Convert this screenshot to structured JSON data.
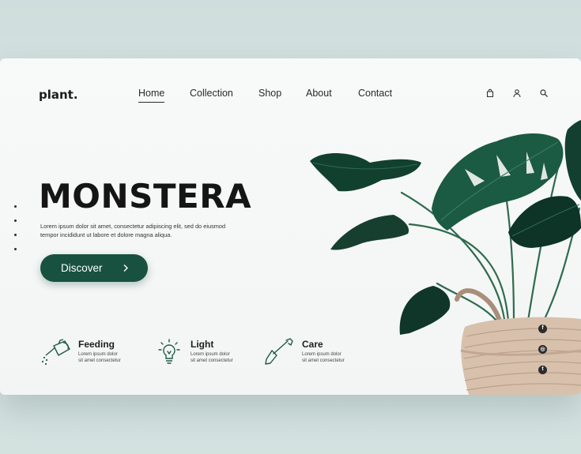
{
  "brand": {
    "logo": "plant."
  },
  "nav": {
    "items": [
      {
        "label": "Home",
        "active": true
      },
      {
        "label": "Collection",
        "active": false
      },
      {
        "label": "Shop",
        "active": false
      },
      {
        "label": "About",
        "active": false
      },
      {
        "label": "Contact",
        "active": false
      }
    ],
    "icons": [
      "bag-icon",
      "user-icon",
      "search-icon"
    ]
  },
  "hero": {
    "title": "MONSTERA",
    "description_line1": "Lorem ipsum dolor sit amet, consectetur adipiscing elit, sed do eiusmod",
    "description_line2": "tempor incididunt ut labore et dolore magna aliqua.",
    "cta_label": "Discover",
    "slide_count": 4
  },
  "features": [
    {
      "title": "Feeding",
      "line1": "Lorem ipsum dolor",
      "line2": "sit amet consectetur",
      "icon": "watering-can-icon"
    },
    {
      "title": "Light",
      "line1": "Lorem ipsum dolor",
      "line2": "sit amet consectetur",
      "icon": "light-bulb-icon"
    },
    {
      "title": "Care",
      "line1": "Lorem ipsum dolor",
      "line2": "sit amet consectetur",
      "icon": "shovel-icon"
    }
  ],
  "social": [
    {
      "name": "facebook-icon",
      "glyph": "f"
    },
    {
      "name": "dribbble-icon",
      "glyph": "◎"
    },
    {
      "name": "twitter-icon",
      "glyph": "t"
    }
  ],
  "colors": {
    "accent": "#18513f",
    "leaf_dark": "#123d31",
    "leaf_mid": "#1f5a45",
    "basket": "#d9c2ad",
    "background": "#d3e1df"
  }
}
